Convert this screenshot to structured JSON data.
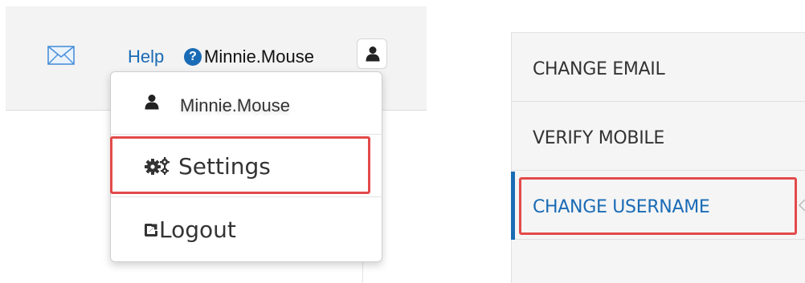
{
  "header": {
    "mail_icon": "envelope-icon",
    "help_label": "Help",
    "help_icon": "question-circle-icon",
    "username": "Minnie.Mouse",
    "user_icon": "user-icon"
  },
  "user_menu": {
    "items": [
      {
        "label": "Minnie.Mouse",
        "icon": "user-icon"
      },
      {
        "label": "Settings",
        "icon": "gears-icon",
        "highlighted": true
      },
      {
        "label": "Logout",
        "icon": "external-link-icon"
      }
    ]
  },
  "settings_menu": {
    "items": [
      {
        "label": "CHANGE EMAIL"
      },
      {
        "label": "VERIFY MOBILE"
      },
      {
        "label": "CHANGE USERNAME",
        "active": true,
        "highlighted": true
      }
    ]
  },
  "colors": {
    "accent": "#1a6bb5",
    "highlight": "#e34a4a"
  }
}
